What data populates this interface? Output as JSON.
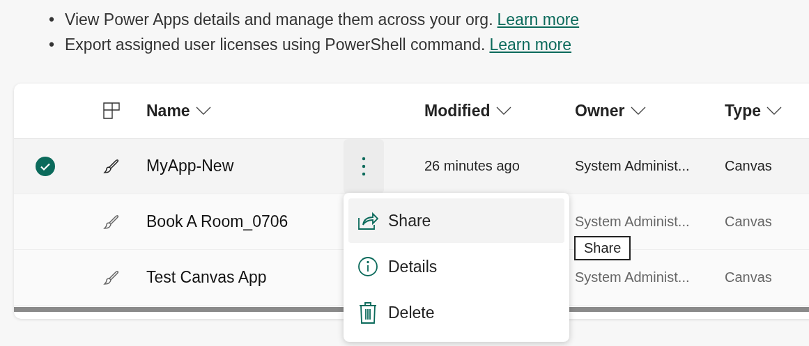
{
  "notes": [
    {
      "marker": "•",
      "text": "View Power Apps details and manage them across your org.",
      "link": "Learn more"
    },
    {
      "marker": "•",
      "text": "Export assigned user licenses using PowerShell command.",
      "link": "Learn more"
    }
  ],
  "table": {
    "columns": [
      "Name",
      "Modified",
      "Owner",
      "Type"
    ],
    "rows": [
      {
        "name": "MyApp-New",
        "modified": "26 minutes ago",
        "owner": "System Administ...",
        "type": "Canvas",
        "selected": true
      },
      {
        "name": "Book A Room_0706",
        "owner": "System Administ...",
        "type": "Canvas",
        "selected": false
      },
      {
        "name": "Test Canvas App",
        "owner": "System Administ...",
        "type": "Canvas",
        "selected": false
      }
    ]
  },
  "context_menu": {
    "items": [
      {
        "label": "Share",
        "selected": true
      },
      {
        "label": "Details",
        "selected": false
      },
      {
        "label": "Delete",
        "selected": false
      }
    ]
  },
  "tooltip": "Share"
}
